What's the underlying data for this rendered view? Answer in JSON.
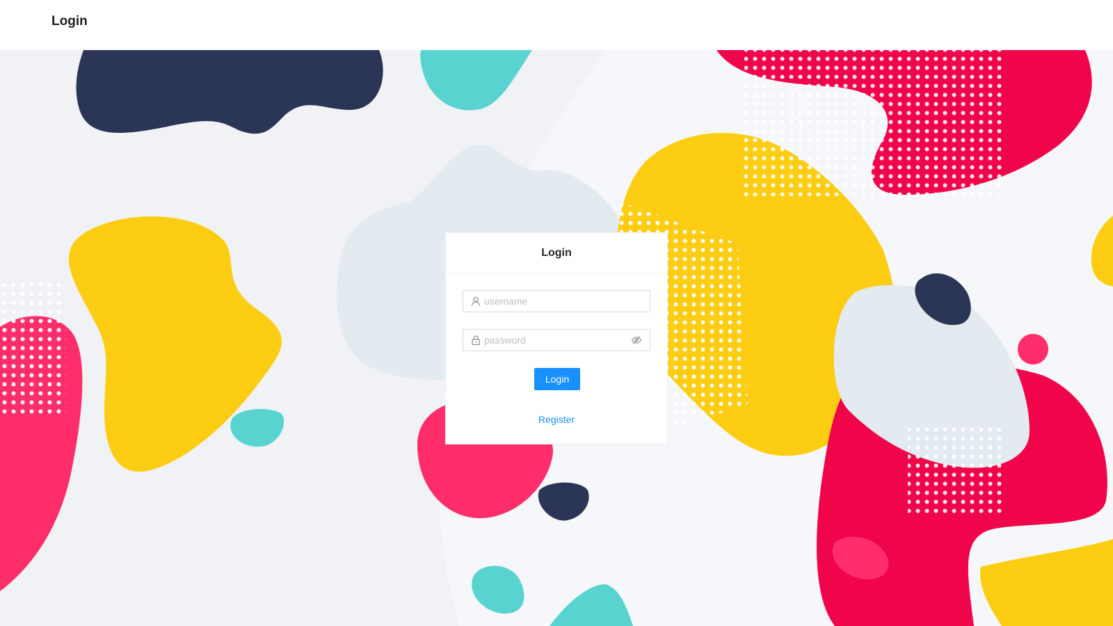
{
  "header": {
    "title": "Login"
  },
  "login_card": {
    "title": "Login",
    "username": {
      "placeholder": "username",
      "value": "",
      "icon": "user-icon"
    },
    "password": {
      "placeholder": "password",
      "value": "",
      "icon": "lock-icon",
      "toggle_icon": "eye-invisible-icon"
    },
    "login_label": "Login",
    "register_label": "Register"
  },
  "colors": {
    "primary": "#1890ff",
    "navy": "#2b3656",
    "teal": "#58d3d0",
    "yellow": "#fdcd13",
    "pink": "#ff2e6a",
    "red": "#f0044a",
    "pale": "#e3eaf0",
    "background": "#f0f2f5"
  }
}
